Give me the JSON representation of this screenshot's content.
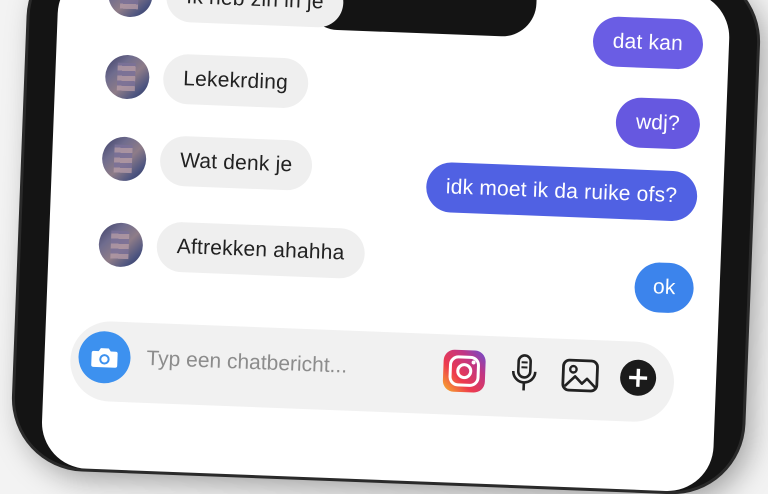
{
  "incoming": [
    {
      "text": "Ik heb zin in je"
    },
    {
      "text": "Lekekrding"
    },
    {
      "text": "Wat denk je"
    },
    {
      "text": "Aftrekken ahahha"
    }
  ],
  "outgoing": [
    {
      "text": "dat kan",
      "color": "#6a5de4"
    },
    {
      "text": "wdj?",
      "color": "#6658e0"
    },
    {
      "text": "idk moet ik da ruike ofs?",
      "color": "#5061e3"
    },
    {
      "text": "ok",
      "color": "#3c84ec"
    }
  ],
  "composer": {
    "placeholder": "Typ een chatbericht...",
    "icons": [
      "camera-icon",
      "instagram-icon",
      "microphone-icon",
      "image-icon",
      "plus-icon"
    ]
  },
  "colors": {
    "camera_button": "#3d91ef",
    "incoming_bubble": "#efefef"
  }
}
